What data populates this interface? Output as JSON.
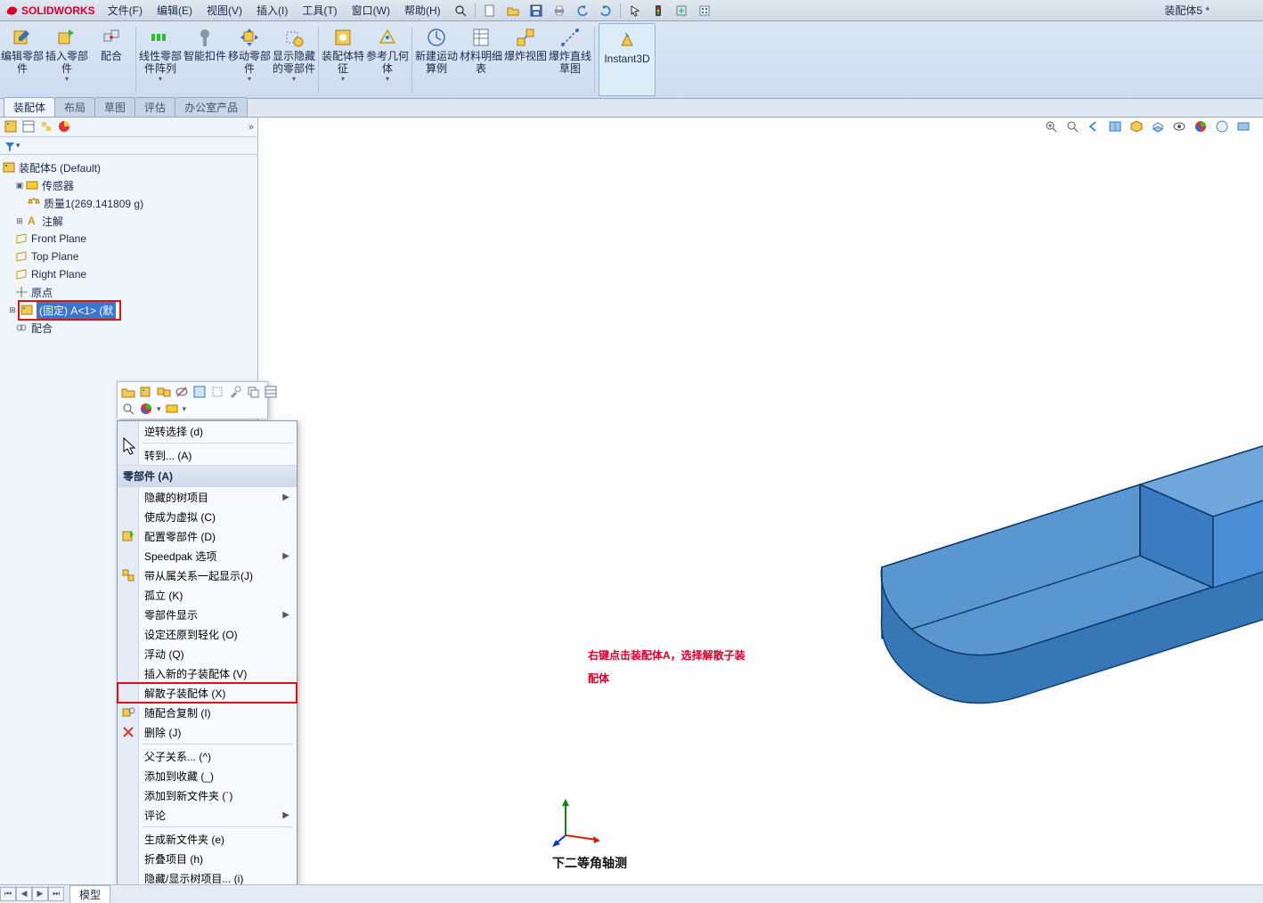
{
  "app": {
    "name": "SOLIDWORKS",
    "doc_title": "装配体5 *"
  },
  "menu": {
    "file": "文件(F)",
    "edit": "编辑(E)",
    "view": "视图(V)",
    "insert": "插入(I)",
    "tools": "工具(T)",
    "window": "窗口(W)",
    "help": "帮助(H)"
  },
  "ribbon": {
    "edit_component": "编辑零部件",
    "insert_component": "插入零部件",
    "mate": "配合",
    "linear_pattern": "线性零部件阵列",
    "smart_fasteners": "智能扣件",
    "move_component": "移动零部件",
    "show_hidden": "显示隐藏的零部件",
    "assembly_features": "装配体特征",
    "ref_geometry": "参考几何体",
    "new_motion": "新建运动算例",
    "bom": "材料明细表",
    "exploded": "爆炸视图",
    "explode_line": "爆炸直线草图",
    "instant3d": "Instant3D"
  },
  "tabs": {
    "assembly": "装配体",
    "layout": "布局",
    "sketch": "草图",
    "evaluate": "评估",
    "office": "办公室产品"
  },
  "tree": {
    "root": "装配体5  (Default)",
    "sensors": "传感器",
    "mass": "质量1(269.141809 g)",
    "annotations": "注解",
    "front": "Front Plane",
    "top": "Top Plane",
    "right": "Right Plane",
    "origin": "原点",
    "selected": "(固定) A<1> (默",
    "mates": "配合"
  },
  "context_menu": {
    "invert_selection": "逆转选择 (d)",
    "go_to": "转到... (A)",
    "components_header": "零部件 (A)",
    "hidden_tree": "隐藏的树项目",
    "make_virtual": "使成为虚拟 (C)",
    "configure": "配置零部件 (D)",
    "speedpak": "Speedpak 选项",
    "show_with_dependents": "带从属关系一起显示(J)",
    "isolate": "孤立 (K)",
    "component_display": "零部件显示",
    "set_lightweight": "设定还原到轻化 (O)",
    "float": "浮动 (Q)",
    "insert_new_sub": "插入新的子装配体 (V)",
    "dissolve_sub": "解散子装配体 (X)",
    "copy_with_mates": "随配合复制 (I)",
    "delete": "删除 (J)",
    "parent_child": "父子关系... (^)",
    "add_to_fav": "添加到收藏 (_)",
    "add_to_new_folder": "添加到新文件夹 (`)",
    "comments": "评论",
    "create_new_folder": "生成新文件夹 (e)",
    "collapse": "折叠项目 (h)",
    "hide_show_tree": "隐藏/显示树项目... (i)"
  },
  "annotation": {
    "line1": "右键点击装配体A，选择解散子装",
    "line2": "配体"
  },
  "viewport": {
    "caption": "下二等角轴测"
  },
  "status": {
    "model_tab": "模型"
  },
  "colors": {
    "accent_red": "#d11a1a",
    "part_fill": "#4a8fd6",
    "part_edge": "#0f3a6a"
  }
}
